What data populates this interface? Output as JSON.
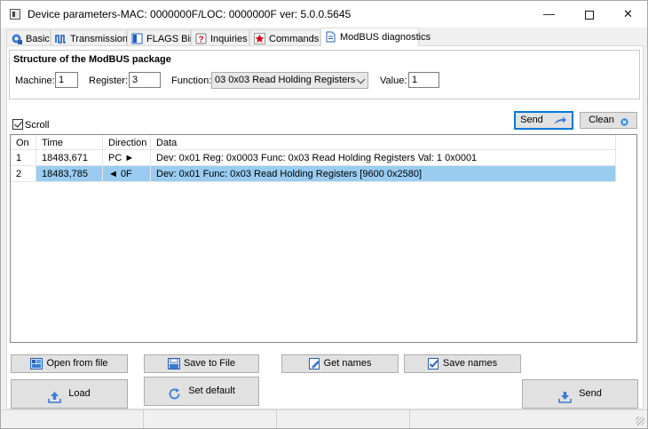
{
  "window": {
    "title": "Device parameters-MAC: 0000000F/LOC: 0000000F ver: 5.0.0.5645",
    "minimize_glyph": "—",
    "close_glyph": "✕"
  },
  "tabs": [
    {
      "label": "Basic",
      "icon": "gear-globe-icon"
    },
    {
      "label": "Transmission",
      "icon": "pulse-wave-icon"
    },
    {
      "label": "FLAGS Bin",
      "icon": "flag-panel-icon"
    },
    {
      "label": "Inquiries",
      "icon": "question-icon"
    },
    {
      "label": "Commands",
      "icon": "star-command-icon"
    },
    {
      "label": "ModBUS diagnostics",
      "icon": "document-icon",
      "active": true
    }
  ],
  "package": {
    "title": "Structure of the ModBUS package",
    "machine_label": "Machine:",
    "machine_value": "1",
    "register_label": "Register:",
    "register_value": "3",
    "function_label": "Function:",
    "function_value": "03 0x03 Read Holding Registers",
    "value_label": "Value:",
    "value_value": "1"
  },
  "scroll": {
    "label": "Scroll",
    "checked": true
  },
  "actions": {
    "send_label": "Send",
    "clean_label": "Clean"
  },
  "table": {
    "columns": [
      "On",
      "Time",
      "Direction",
      "Data"
    ],
    "rows": [
      {
        "on": "1",
        "time": "18483,671",
        "direction": "PC ►",
        "data": "Dev: 0x01 Reg: 0x0003 Func: 0x03 Read Holding Registers Val: 1 0x0001"
      },
      {
        "on": "2",
        "time": "18483,785",
        "direction": "◄ 0F",
        "data": "Dev: 0x01 Func: 0x03 Read Holding Registers [9600 0x2580]",
        "selected": true
      }
    ]
  },
  "bottom": {
    "open_from_file": "Open from file",
    "save_to_file": "Save to File",
    "get_names": "Get names",
    "save_names": "Save names",
    "load": "Load",
    "set_default": "Set default",
    "send": "Send"
  },
  "colors": {
    "selection": "#99ccf0",
    "accent": "#0078d7",
    "button_face": "#e1e1e1"
  }
}
